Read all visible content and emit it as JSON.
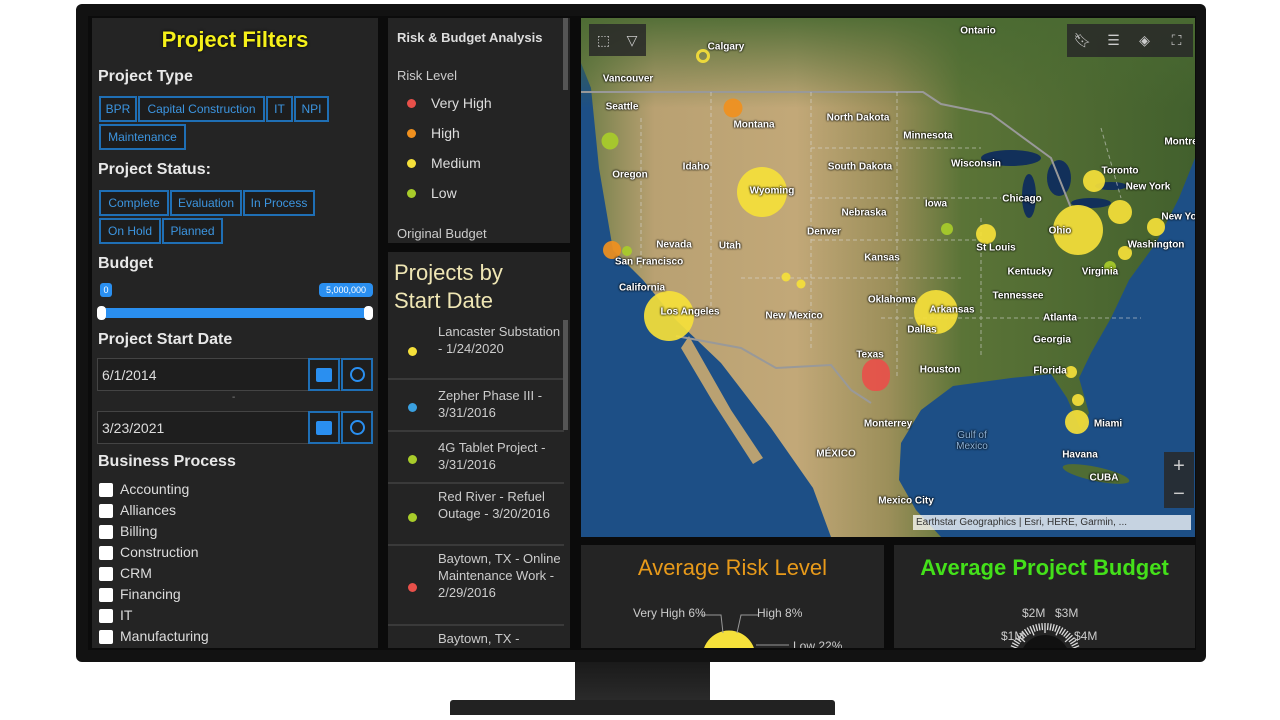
{
  "filters": {
    "title": "Project Filters",
    "project_type_label": "Project Type",
    "project_types": [
      "BPR",
      "Capital Construction",
      "IT",
      "NPI",
      "Maintenance"
    ],
    "project_status_label": "Project Status:",
    "project_statuses": [
      "Complete",
      "Evaluation",
      "In Process",
      "On Hold",
      "Planned"
    ],
    "budget_label": "Budget",
    "budget_min": "0",
    "budget_max": "5,000,000",
    "start_date_label": "Project Start Date",
    "start_date_from": "6/1/2014",
    "date_separator": "-",
    "start_date_to": "3/23/2021",
    "business_process_label": "Business Process",
    "business_processes": [
      "Accounting",
      "Alliances",
      "Billing",
      "Construction",
      "CRM",
      "Financing",
      "IT",
      "Manufacturing"
    ]
  },
  "legend": {
    "title": "Risk & Budget Analysis",
    "risk_label": "Risk Level",
    "items": [
      {
        "label": "Very High",
        "color": "#e8504a"
      },
      {
        "label": "High",
        "color": "#f0901e"
      },
      {
        "label": "Medium",
        "color": "#f5e03a"
      },
      {
        "label": "Low",
        "color": "#a8cc2a"
      }
    ],
    "budget_label": "Original Budget"
  },
  "projects": {
    "title": "Projects by Start Date",
    "items": [
      {
        "text": "Lancaster Substation - 1/24/2020",
        "color": "#f5e03a"
      },
      {
        "text": "Zepher Phase III - 3/31/2016",
        "color": "#3aa0e0"
      },
      {
        "text": "4G Tablet Project - 3/31/2016",
        "color": "#a8cc2a"
      },
      {
        "text": "Red River - Refuel Outage - 3/20/2016",
        "color": "#a8cc2a"
      },
      {
        "text": "Baytown, TX - Online Maintenance Work - 2/29/2016",
        "color": "#e8504a"
      },
      {
        "text": "Baytown, TX -",
        "color": ""
      }
    ]
  },
  "map": {
    "labels": [
      "Ontario",
      "Calgary",
      "Vancouver",
      "Seattle",
      "Montana",
      "North Dakota",
      "Minnesota",
      "Oregon",
      "Idaho",
      "South Dakota",
      "Wisconsin",
      "Toronto",
      "New York",
      "Wyoming",
      "Chicago",
      "Iowa",
      "Nebraska",
      "Denver",
      "Nevada",
      "Utah",
      "Ohio",
      "St Louis",
      "Washington",
      "Kansas",
      "San Francisco",
      "Kentucky",
      "Virginia",
      "California",
      "Oklahoma",
      "Tennessee",
      "Los Angeles",
      "New Mexico",
      "Arkansas",
      "Atlanta",
      "Dallas",
      "Georgia",
      "Texas",
      "Houston",
      "Florida",
      "Monterrey",
      "Miami",
      "Gulf of Mexico",
      "Havana",
      "MÉXICO",
      "CUBA",
      "Mexico City",
      "Montre",
      "New Yo"
    ],
    "attribution": "Earthstar Geographics | Esri, HERE, Garmin, ...",
    "zoom_in": "+",
    "zoom_out": "−",
    "icons": [
      "select-icon",
      "dropdown-icon",
      "bookmark-icon",
      "layer-list-icon",
      "basemap-icon",
      "fullscreen-icon"
    ]
  },
  "risk_gauge": {
    "title": "Average Risk Level",
    "title_color": "#e89a1a",
    "slices": [
      {
        "label": "Very High 6%",
        "value": 6,
        "color": "#e8201a"
      },
      {
        "label": "High 8%",
        "value": 8,
        "color": "#f0901e"
      },
      {
        "label": "Low 22%",
        "value": 22,
        "color": "#a8cc2a"
      },
      {
        "label": "",
        "value": 64,
        "color": "#f5e03a"
      }
    ]
  },
  "budget_gauge": {
    "title": "Average Project Budget",
    "title_color": "#44e01a",
    "ticks": [
      "$1M",
      "$2M",
      "$3M",
      "$4M"
    ]
  }
}
